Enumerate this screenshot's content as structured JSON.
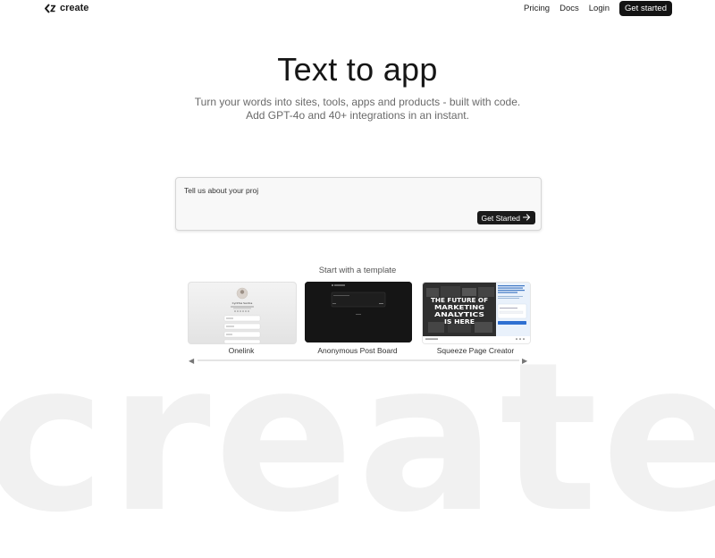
{
  "header": {
    "brand": "create",
    "nav": {
      "pricing": "Pricing",
      "docs": "Docs",
      "login": "Login",
      "cta": "Get started"
    }
  },
  "hero": {
    "title": "Text to app",
    "subtitle_line1": "Turn your words into sites, tools, apps and products - built with code.",
    "subtitle_line2": "Add GPT-4o and 40+ integrations in an instant."
  },
  "prompt": {
    "value": "Tell us about your proj",
    "submit_label": "Get Started"
  },
  "templates": {
    "heading": "Start with a template",
    "items": [
      {
        "label": "Onelink",
        "preview_name": "Cynthia Santos"
      },
      {
        "label": "Anonymous Post Board"
      },
      {
        "label": "Squeeze Page Creator",
        "preview_headline": "THE FUTURE OF MARKETING ANALYTICS IS HERE"
      }
    ]
  },
  "icons": {
    "brand_logo": "create-logo-icon",
    "submit_arrow": "arrow-right-icon",
    "carousel_prev": "chevron-left-icon",
    "carousel_next": "chevron-right-icon"
  },
  "colors": {
    "primary": "#141414",
    "background": "#ffffff",
    "muted_text": "#6a6a6a",
    "watermark": "#f1f1f1"
  },
  "watermark_text": "create"
}
